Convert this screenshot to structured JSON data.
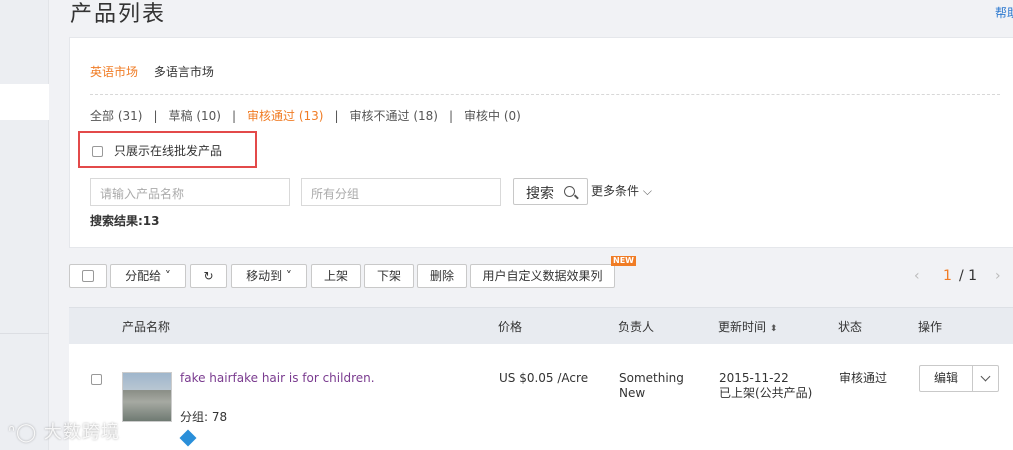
{
  "page": {
    "title": "产品列表",
    "help": "帮助"
  },
  "market_tabs": [
    {
      "label": "英语市场",
      "active": true
    },
    {
      "label": "多语言市场",
      "active": false
    }
  ],
  "status_tabs": [
    {
      "label": "全部 (31)",
      "active": false
    },
    {
      "label": "草稿 (10)",
      "active": false
    },
    {
      "label": "审核通过 (13)",
      "active": true
    },
    {
      "label": "审核不通过 (18)",
      "active": false
    },
    {
      "label": "审核中 (0)",
      "active": false
    }
  ],
  "filters": {
    "wholesale_only_label": "只展示在线批发产品",
    "name_placeholder": "请输入产品名称",
    "category_placeholder": "所有分组",
    "search_label": "搜索",
    "more_conditions": "更多条件",
    "result_count": "搜索结果:13"
  },
  "toolbar": {
    "assign": "分配给",
    "move_to": "移动到",
    "list": "上架",
    "delist": "下架",
    "delete": "删除",
    "custom_columns": "用户自定义数据效果列",
    "new_badge": "NEW"
  },
  "pagination": {
    "current": "1",
    "total": "/ 1"
  },
  "table": {
    "headers": {
      "name": "产品名称",
      "price": "价格",
      "owner": "负责人",
      "updated": "更新时间",
      "status": "状态",
      "action": "操作"
    },
    "rows": [
      {
        "name": "fake hairfake hair is for children.",
        "group": "分组: 78",
        "price": "US $0.05 /Acre",
        "owner_line1": "Something",
        "owner_line2": "New",
        "date": "2015-11-22",
        "listing": "已上架(公共产品)",
        "status": "审核通过",
        "action": "编辑"
      }
    ]
  },
  "watermark": "大数跨境",
  "colors": {
    "accent": "#f07c25",
    "highlight_border": "#e34a4a",
    "link_purple": "#7a3b8f"
  },
  "icons": [
    "search-icon",
    "refresh-icon",
    "chevron-down-icon",
    "chevron-left-icon",
    "chevron-right-icon",
    "sort-icon",
    "diamond-icon"
  ]
}
